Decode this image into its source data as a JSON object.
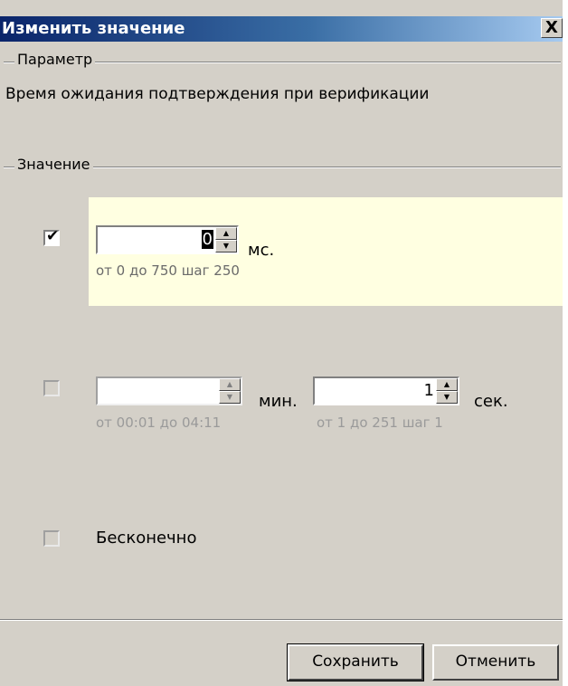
{
  "dialog": {
    "title": "Изменить значение",
    "close_label": "X"
  },
  "parameter": {
    "group_label": "Параметр",
    "text": "Время ожидания подтверждения при верификации"
  },
  "value_group": {
    "label": "Значение"
  },
  "option_ms": {
    "checked": true,
    "value": "0",
    "unit": "мс.",
    "hint": "от 0 до 750 шаг 250"
  },
  "option_minsec": {
    "checked": false,
    "minutes": {
      "value": "",
      "unit": "мин.",
      "hint": "от 00:01 до 04:11"
    },
    "seconds": {
      "value": "1",
      "unit": "сек.",
      "hint": "от 1 до 251 шаг 1"
    }
  },
  "option_infinite": {
    "checked": false,
    "label": "Бесконечно"
  },
  "footer": {
    "save_label": "Сохранить",
    "cancel_label": "Отменить"
  },
  "icons": {
    "checkmark": "✔",
    "spin_up": "▲",
    "spin_down": "▼"
  }
}
